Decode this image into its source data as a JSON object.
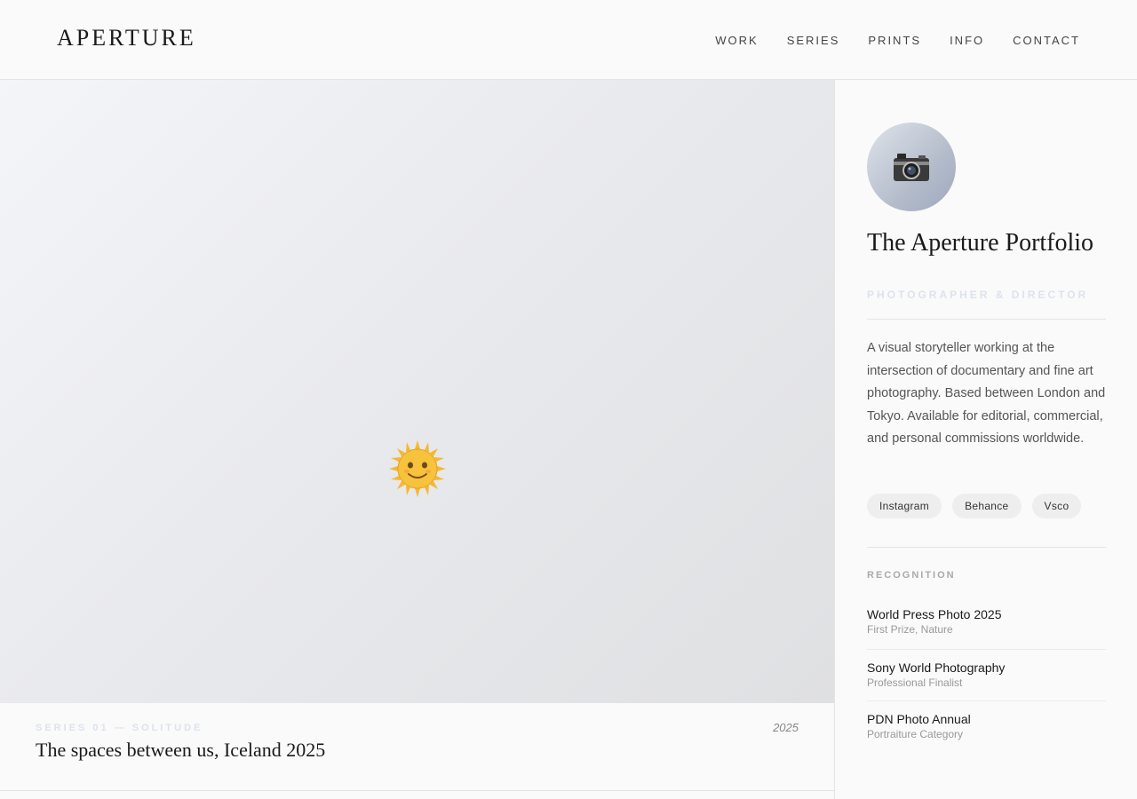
{
  "header": {
    "logo": "APERTURE",
    "nav": [
      "WORK",
      "SERIES",
      "PRINTS",
      "INFO",
      "CONTACT"
    ]
  },
  "hero": {
    "icon": "sun-face-icon",
    "series_label": "SERIES 01 — SOLITUDE",
    "year": "2025",
    "title": "The spaces between us, Iceland 2025"
  },
  "sidebar": {
    "avatar_icon": "camera-icon",
    "title": "The Aperture Portfolio",
    "role": "PHOTOGRAPHER & DIRECTOR",
    "bio": "A visual storyteller working at the intersection of documentary and fine art photography. Based between London and Tokyo. Available for editorial, commercial, and personal commissions worldwide.",
    "social": [
      "Instagram",
      "Behance",
      "Vsco"
    ],
    "recognition_label": "RECOGNITION",
    "recognition": [
      {
        "name": "World Press Photo 2025",
        "detail": "First Prize, Nature"
      },
      {
        "name": "Sony World Photography",
        "detail": "Professional Finalist"
      },
      {
        "name": "PDN Photo Annual",
        "detail": "Portraiture Category"
      }
    ]
  },
  "colors": {
    "accent_muted": "#dde2ec",
    "text": "#1a1a1a",
    "border": "#e4e4e4"
  }
}
